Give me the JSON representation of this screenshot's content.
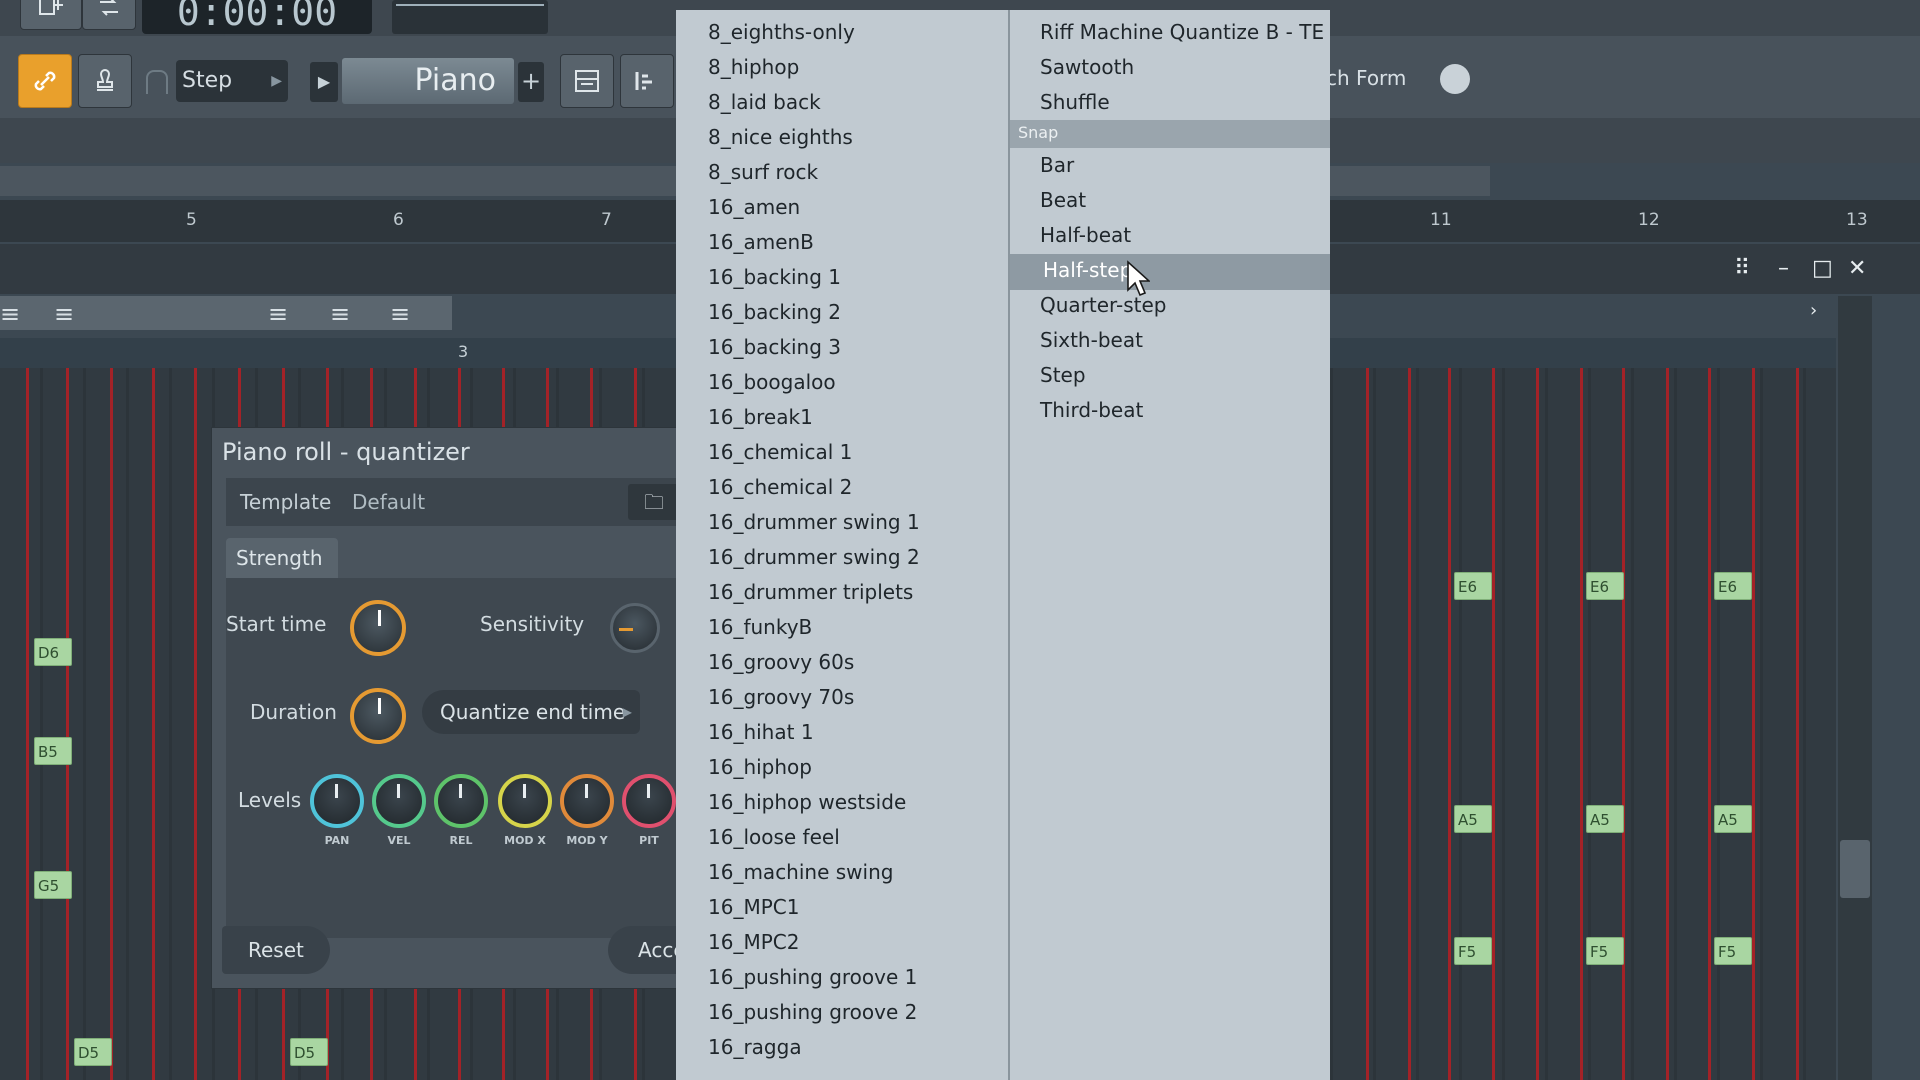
{
  "toolbar": {
    "time": "0:00:00",
    "snap_mode": "Step",
    "channel": "Piano",
    "add_label": "+",
    "form_label": "ch Form"
  },
  "timeline": {
    "bars": [
      "5",
      "6",
      "7",
      "11",
      "12",
      "13"
    ]
  },
  "ruler": {
    "marker": "3"
  },
  "quantizer": {
    "title": "Piano roll - quantizer",
    "template_label": "Template",
    "template_value": "Default",
    "strength_tab": "Strength",
    "start_time_label": "Start time",
    "sensitivity_label": "Sensitivity",
    "duration_label": "Duration",
    "duration_mode": "Quantize end time",
    "levels_label": "Levels",
    "level_knobs": [
      "PAN",
      "VEL",
      "REL",
      "MOD X",
      "MOD Y",
      "PIT"
    ],
    "reset_label": "Reset",
    "accept_label": "Acce"
  },
  "notes": {
    "left": [
      "D6",
      "B5",
      "G5",
      "D5",
      "D5"
    ],
    "right": [
      "E6",
      "E6",
      "E6",
      "A5",
      "A5",
      "A5",
      "F5",
      "F5",
      "F5"
    ]
  },
  "menu_left": [
    "8_eighths-only",
    "8_hiphop",
    "8_laid back",
    "8_nice eighths",
    "8_surf rock",
    "16_amen",
    "16_amenB",
    "16_backing 1",
    "16_backing 2",
    "16_backing 3",
    "16_boogaloo",
    "16_break1",
    "16_chemical 1",
    "16_chemical 2",
    "16_drummer swing 1",
    "16_drummer swing 2",
    "16_drummer triplets",
    "16_funkyB",
    "16_groovy 60s",
    "16_groovy 70s",
    "16_hihat 1",
    "16_hiphop",
    "16_hiphop westside",
    "16_loose feel",
    "16_machine swing",
    "16_MPC1",
    "16_MPC2",
    "16_pushing groove 1",
    "16_pushing groove 2",
    "16_ragga"
  ],
  "menu_right_top": [
    "Riff Machine Quantize B - TE",
    "Sawtooth",
    "Shuffle"
  ],
  "menu_section": "Snap",
  "menu_right_snap": [
    "Bar",
    "Beat",
    "Half-beat",
    "Half-step",
    "Quarter-step",
    "Sixth-beat",
    "Step",
    "Third-beat"
  ],
  "menu_selected": "Half-step",
  "colors": {
    "accent_orange": "#e59a32",
    "grid_red": "#a32227",
    "note_green": "#a9d6a2",
    "menu_bg": "#c1cad1",
    "menu_highlight": "#8e9aa3"
  }
}
